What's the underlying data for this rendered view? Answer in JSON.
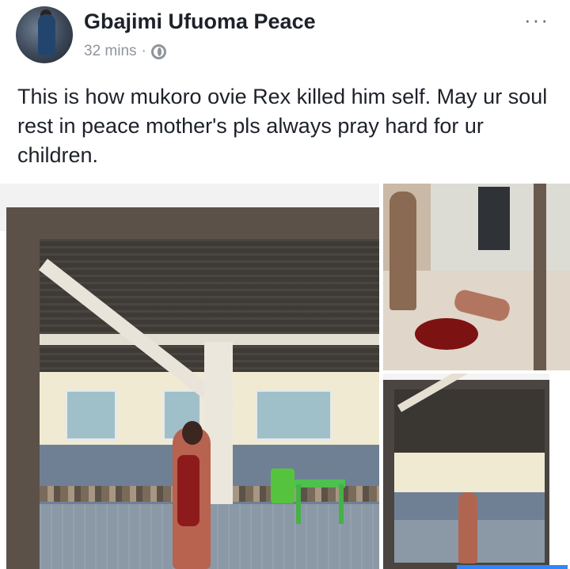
{
  "post": {
    "author": "Gbajimi Ufuoma Peace",
    "time": "32 mins",
    "separator": "·",
    "privacy_icon": "globe-icon",
    "more_label": "···",
    "text": "This is how mukoro ovie Rex killed him self. May ur soul rest in peace mother's pls always pray hard for ur children."
  },
  "colors": {
    "name_text": "#1d2129",
    "meta_text": "#90949c",
    "accent": "#2d88ff"
  }
}
